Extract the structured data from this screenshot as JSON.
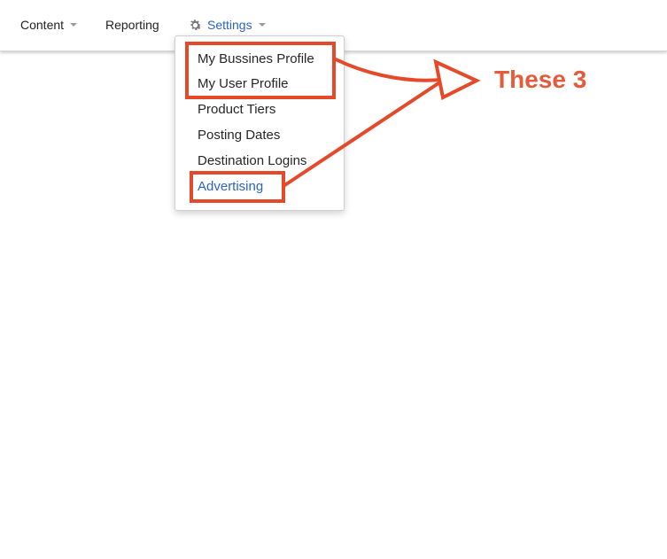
{
  "nav": {
    "items": [
      {
        "label": "Content"
      },
      {
        "label": "Reporting"
      },
      {
        "label": "Settings",
        "icon": "gear-icon"
      }
    ]
  },
  "dropdown": {
    "items": [
      {
        "label": "My Bussines Profile"
      },
      {
        "label": "My User Profile"
      },
      {
        "label": "Product Tiers"
      },
      {
        "label": "Posting Dates"
      },
      {
        "label": "Destination Logins"
      },
      {
        "label": "Advertising"
      }
    ]
  },
  "annotation": {
    "label": "These 3",
    "color": "#e44a2a"
  },
  "colors": {
    "link": "#2a64c5",
    "text": "#262626",
    "annotation": "#e44a2a"
  }
}
